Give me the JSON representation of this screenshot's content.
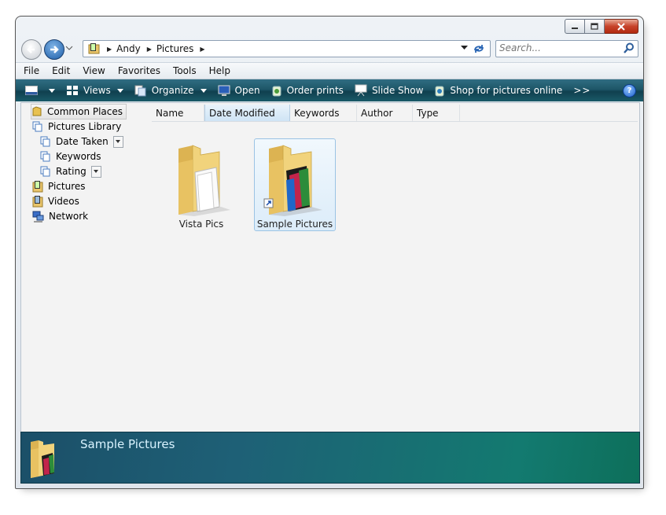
{
  "window": {
    "caption_buttons": [
      "minimize-icon",
      "maximize-icon",
      "close-icon"
    ]
  },
  "nav": {
    "breadcrumbs": [
      "Andy",
      "Pictures"
    ],
    "search_placeholder": "Search..."
  },
  "menu": {
    "items": [
      "File",
      "Edit",
      "View",
      "Favorites",
      "Tools",
      "Help"
    ]
  },
  "commands": {
    "views": "Views",
    "organize": "Organize",
    "open": "Open",
    "order_prints": "Order prints",
    "slide_show": "Slide Show",
    "shop": "Shop for pictures online",
    "more": ">>",
    "help": "?"
  },
  "tree": {
    "items": [
      "Common Places",
      "Pictures Library",
      "Date Taken",
      "Keywords",
      "Rating",
      "Pictures",
      "Videos",
      "Network"
    ]
  },
  "columns": [
    "Name",
    "Date Modified",
    "Keywords",
    "Author",
    "Type"
  ],
  "files": [
    {
      "label": "Vista Pics"
    },
    {
      "label": "Sample Pictures"
    }
  ],
  "details": {
    "title": "Sample Pictures"
  },
  "colors": {
    "command_bar": "#1e5668",
    "details_pane": "#1e6076",
    "selection": "#dcecf9"
  }
}
